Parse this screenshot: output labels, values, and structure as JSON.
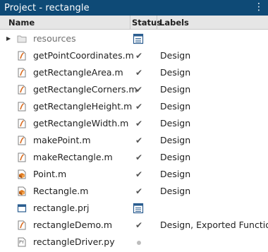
{
  "title": "Project - rectangle",
  "columns": {
    "name": "Name",
    "status": "Status",
    "labels": "Labels"
  },
  "rows": [
    {
      "name": "resources",
      "icon": "folder-icon",
      "status": "project-icon",
      "label": ""
    },
    {
      "name": "getPointCoordinates.m",
      "icon": "mfile-icon",
      "status": "check",
      "label": "Design"
    },
    {
      "name": "getRectangleArea.m",
      "icon": "mfile-icon",
      "status": "check",
      "label": "Design"
    },
    {
      "name": "getRectangleCorners.m",
      "icon": "mfile-icon",
      "status": "check",
      "label": "Design"
    },
    {
      "name": "getRectangleHeight.m",
      "icon": "mfile-icon",
      "status": "check",
      "label": "Design"
    },
    {
      "name": "getRectangleWidth.m",
      "icon": "mfile-icon",
      "status": "check",
      "label": "Design"
    },
    {
      "name": "makePoint.m",
      "icon": "mfile-icon",
      "status": "check",
      "label": "Design"
    },
    {
      "name": "makeRectangle.m",
      "icon": "mfile-icon",
      "status": "check",
      "label": "Design"
    },
    {
      "name": "Point.m",
      "icon": "class-icon",
      "status": "check",
      "label": "Design"
    },
    {
      "name": "Rectangle.m",
      "icon": "class-icon",
      "status": "check",
      "label": "Design"
    },
    {
      "name": "rectangle.prj",
      "icon": "prj-icon",
      "status": "project-icon",
      "label": ""
    },
    {
      "name": "rectangleDemo.m",
      "icon": "mfile-icon",
      "status": "check",
      "label": "Design, Exported Function"
    },
    {
      "name": "rectangleDriver.py",
      "icon": "py-icon",
      "status": "dot",
      "label": ""
    }
  ],
  "check_glyph": "✔",
  "menu_glyph": "⋮",
  "py_icon_text": "PY"
}
